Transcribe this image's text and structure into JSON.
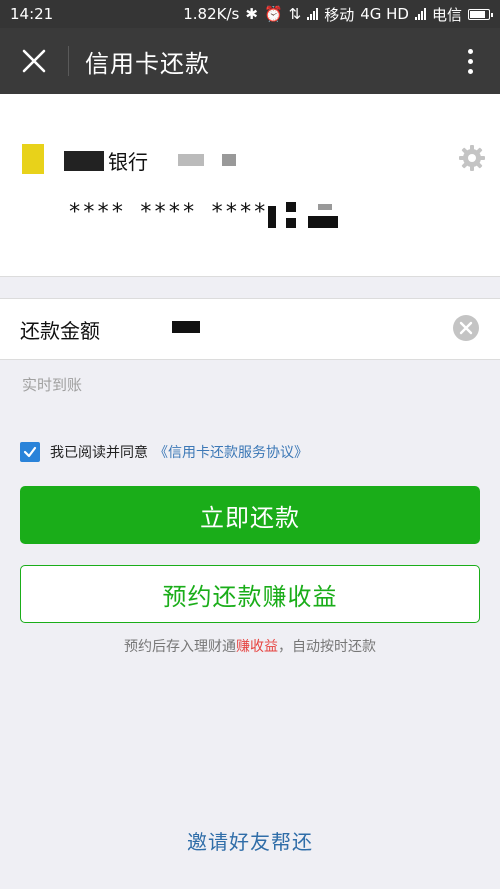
{
  "status_bar": {
    "time": "14:21",
    "network_speed": "1.82K/s",
    "carrier1": "移动",
    "network_type": "4G HD",
    "carrier2": "电信"
  },
  "nav": {
    "title": "信用卡还款",
    "close_icon": "close-icon",
    "more_icon": "more-vertical-icon"
  },
  "card": {
    "bank_name": "银行",
    "card_number": "**** **** ****",
    "logo_color": "#e8d21a",
    "settings_icon": "gear-icon"
  },
  "amount": {
    "label": "还款金额",
    "clear_icon": "clear-icon"
  },
  "arrival_note": "实时到账",
  "agreement": {
    "checked": true,
    "text": "我已阅读并同意",
    "link_text": "《信用卡还款服务协议》"
  },
  "buttons": {
    "pay_now": "立即还款",
    "reserve": "预约还款赚收益"
  },
  "reserve_note": {
    "prefix": "预约后存入理财通",
    "highlight": "赚收益",
    "suffix": "，自动按时还款"
  },
  "invite_link": "邀请好友帮还",
  "colors": {
    "accent_green": "#1aad19",
    "link_blue": "#3c78b6",
    "highlight_red": "#e64340",
    "nav_bg": "#3a3a3a"
  }
}
